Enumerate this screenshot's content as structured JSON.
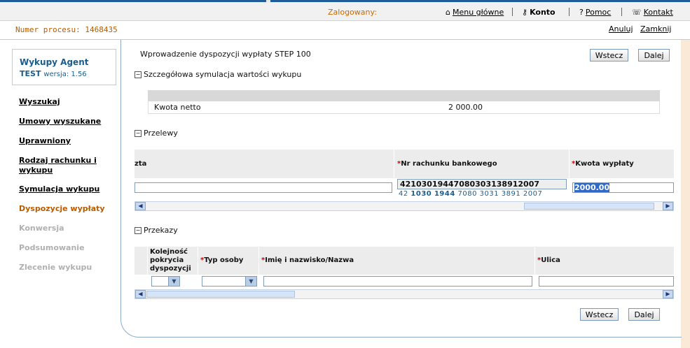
{
  "header": {
    "logged_in_label": "Zalogowany:",
    "menu_label": "Menu główne",
    "account_label": "Konto",
    "help_label": "Pomoc",
    "contact_label": "Kontakt"
  },
  "subbar": {
    "process_label": "Numer procesu: 1468435",
    "cancel_label": "Anuluj",
    "close_label": "Zamknij"
  },
  "app": {
    "title": "Wykupy Agent",
    "env": "TEST",
    "version": "wersja: 1.56"
  },
  "sidebar": {
    "items": [
      {
        "label": "Wyszukaj"
      },
      {
        "label": "Umowy wyszukane"
      },
      {
        "label": "Uprawniony"
      },
      {
        "label": "Rodzaj rachunku i wykupu"
      },
      {
        "label": "Symulacja wykupu"
      },
      {
        "label": "Dyspozycje wypłaty"
      },
      {
        "label": "Konwersja"
      },
      {
        "label": "Podsumowanie"
      },
      {
        "label": "Zlecenie wykupu"
      }
    ]
  },
  "page": {
    "title": "Wprowadzenie dyspozycji wypłaty STEP 100",
    "back_label": "Wstecz",
    "next_label": "Dalej"
  },
  "simulation": {
    "section_title": "Szczegółowa symulacja wartości wykupu",
    "row_label": "Kwota netto",
    "row_value": "2 000.00"
  },
  "transfers": {
    "section_title": "Przelewy",
    "col_partial": "zta",
    "col_account": "Nr rachunku bankowego",
    "col_amount": "Kwota wypłaty",
    "account_value": "42103019447080303138912007",
    "account_formatted": {
      "p1": "42",
      "p2": "1030",
      "p3": "1944",
      "p4": "7080 3031 3891 2007"
    },
    "amount_value": "2000.00"
  },
  "transfers_out": {
    "section_title": "Przekazy",
    "col_order": "Kolejność pokrycia dyspozycji",
    "col_person_type": "Typ osoby",
    "col_name": "Imię i nazwisko/Nazwa",
    "col_street": "Ulica"
  },
  "colors": {
    "accent": "#1a5d8c",
    "active": "#b85c00",
    "required": "#dd0000",
    "background": "#fbe9d7"
  }
}
